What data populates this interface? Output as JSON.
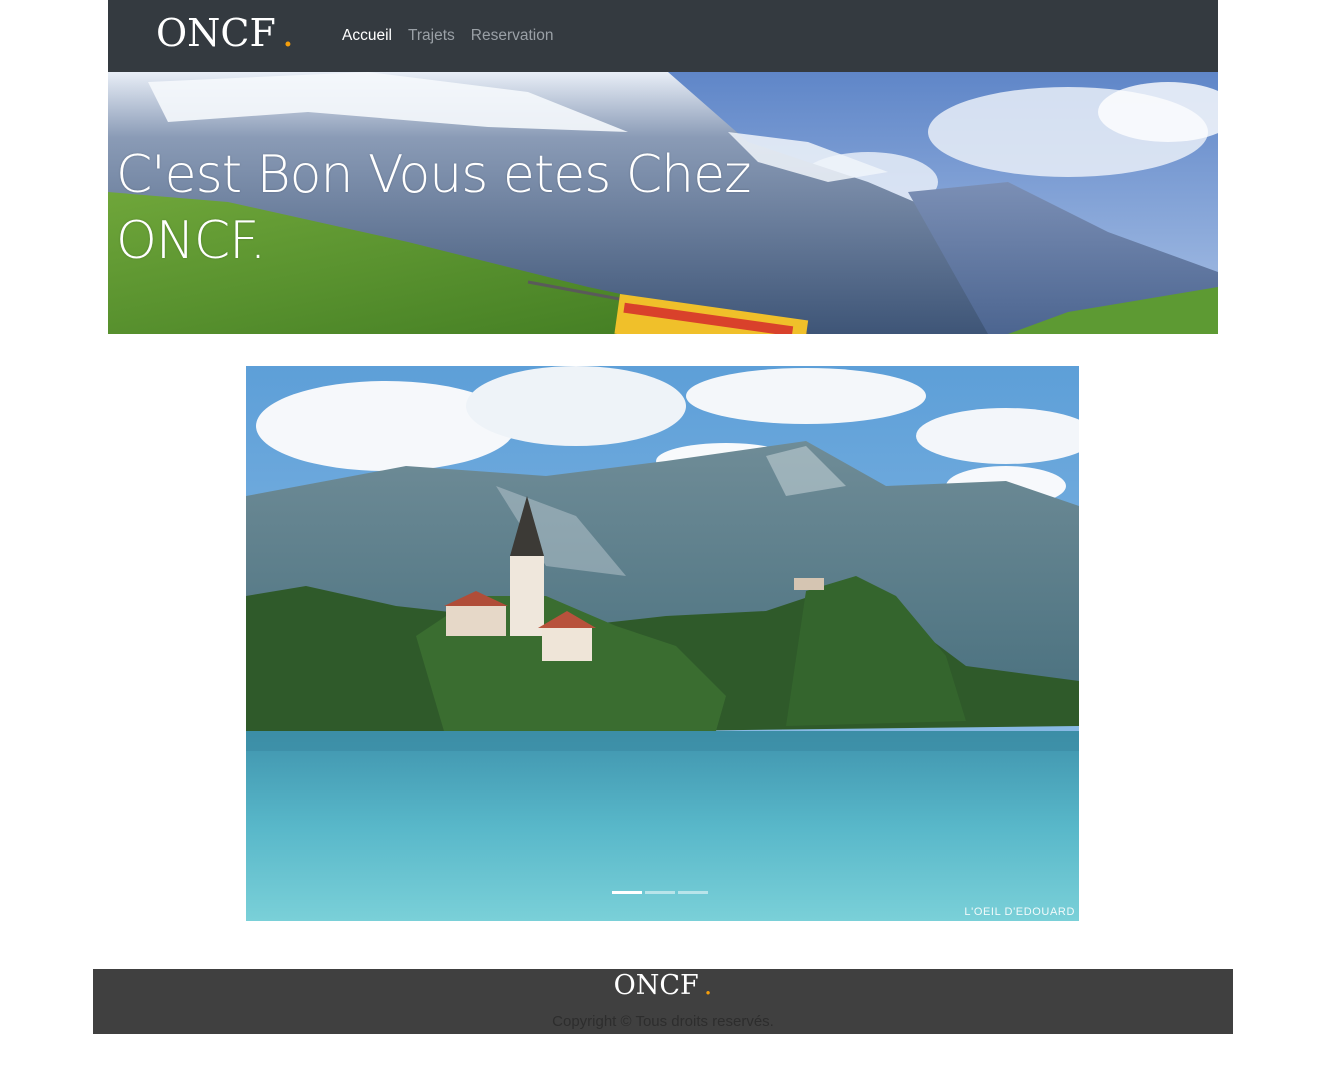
{
  "navbar": {
    "brand": "ONCF",
    "brand_dot": ".",
    "links": [
      {
        "label": "Accueil",
        "active": true
      },
      {
        "label": "Trajets",
        "active": false
      },
      {
        "label": "Reservation",
        "active": false
      }
    ]
  },
  "hero": {
    "title": "C'est Bon Vous etes Chez ONCF."
  },
  "carousel": {
    "watermark": "L'OEIL D'EDOUARD",
    "slide_count": 3,
    "active_slide": 1
  },
  "footer": {
    "brand": "ONCF",
    "brand_dot": ".",
    "copyright": "Copyright © Tous droits reservés."
  },
  "colors": {
    "navbar_bg": "#343a40",
    "accent_dot": "#f59e0b",
    "footer_bg": "#404040"
  }
}
